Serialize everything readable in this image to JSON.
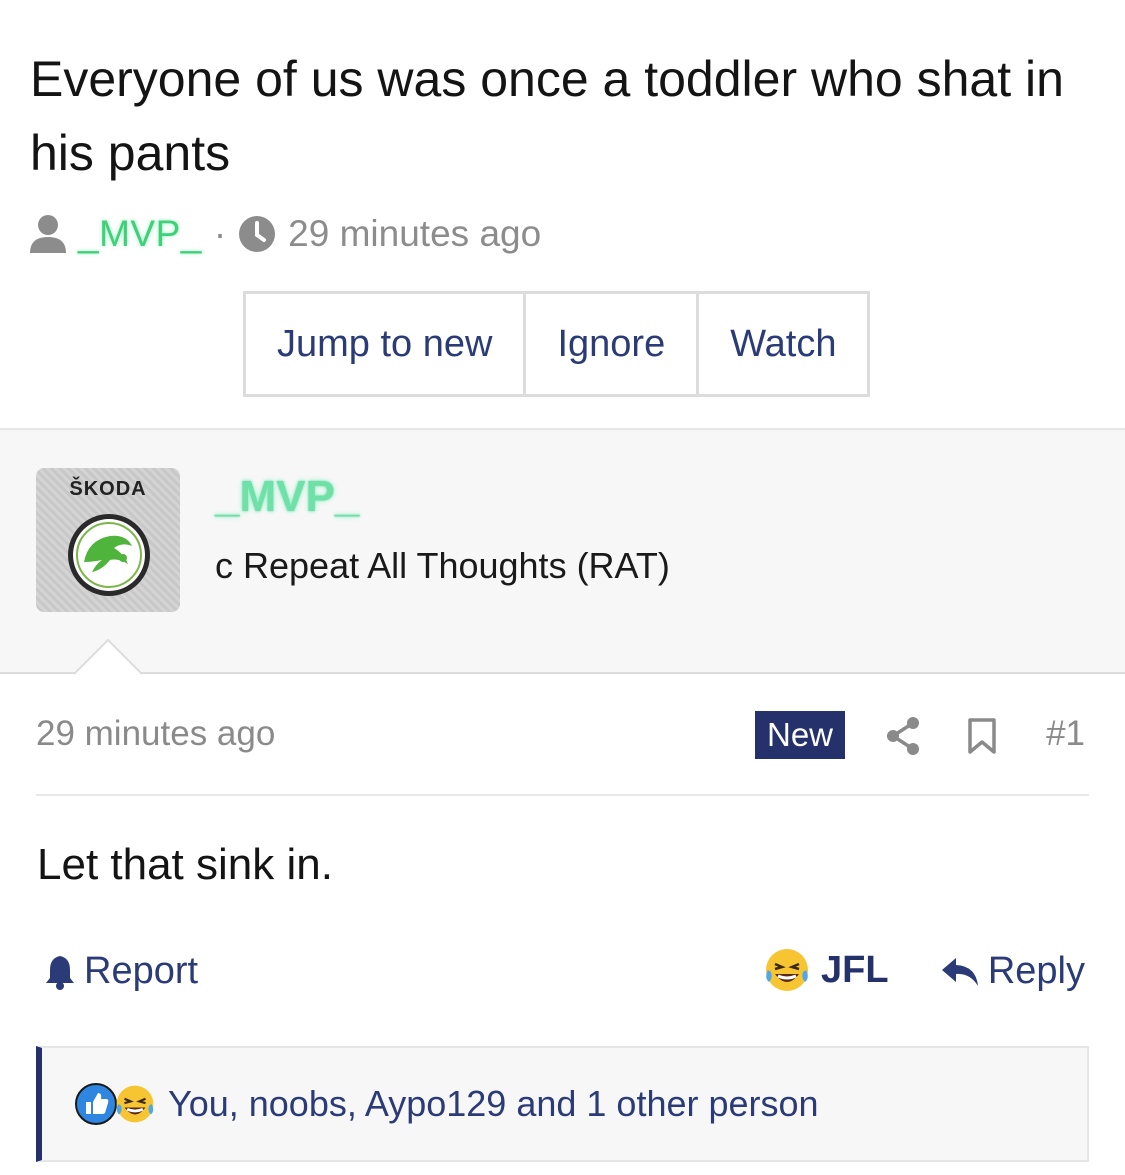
{
  "thread": {
    "title": "Everyone of us was once a toddler who shat in his pants",
    "author": "_MVP_",
    "separator": "·",
    "time": "29 minutes ago"
  },
  "actions": {
    "jump_to_new": "Jump to new",
    "ignore": "Ignore",
    "watch": "Watch"
  },
  "author_block": {
    "avatar_brand": "ŠKODA",
    "username": "_MVP_",
    "user_title": "c Repeat All Thoughts (RAT)"
  },
  "post": {
    "time": "29 minutes ago",
    "badge": "New",
    "number": "#1",
    "body": "Let that sink in."
  },
  "footer": {
    "report": "Report",
    "reaction_label": "JFL",
    "reply": "Reply"
  },
  "reactions": {
    "summary": "You, noobs, Aypo129 and 1 other person"
  },
  "colors": {
    "accent": "#24316b",
    "link": "#2b3b78",
    "username_glow": "#6ee0a8",
    "muted": "#8a8a8a"
  },
  "icons": [
    "user-icon",
    "clock-icon",
    "share-icon",
    "bookmark-icon",
    "bell-icon",
    "laughing-emoji-icon",
    "reply-icon",
    "like-icon"
  ]
}
